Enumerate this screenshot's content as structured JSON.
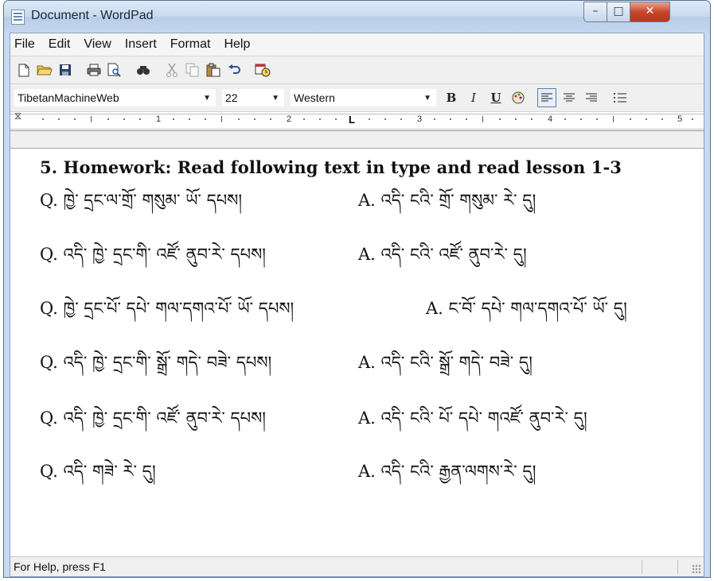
{
  "window": {
    "title": "Document - WordPad",
    "min_symbol": "–",
    "max_symbol": "□",
    "close_symbol": "✕"
  },
  "menu": [
    "File",
    "Edit",
    "View",
    "Insert",
    "Format",
    "Help"
  ],
  "toolbar_icons": [
    "new-document",
    "open-folder",
    "save",
    "print",
    "print-preview",
    "find",
    "cut",
    "copy",
    "paste",
    "undo",
    "date-time"
  ],
  "format": {
    "font": "TibetanMachineWeb",
    "size": "22",
    "script": "Western",
    "bold": "B",
    "italic": "I",
    "underline": "U"
  },
  "ruler": {
    "numbers": [
      "1",
      "2",
      "3",
      "4",
      "5"
    ],
    "tab_marker": "L"
  },
  "document": {
    "heading": "5. Homework: Read following text in type and read lesson 1-3",
    "lines": [
      {
        "q": "Q. ཁྱེ་ དྲང་ལ་གྲོ་ གསུམ་ ཡོ་ དཔས།",
        "a": "A. འདི་ ངའི་ གྲོ་ གསུམ་ རེ་ དུ།"
      },
      {
        "q": "Q. འདི་ ཁྱེ་ དྲང་གི་ འཛོ་ ནུབ་རེ་ དཔས།",
        "a": "A. འདི་ ངའི་ འཛོ་ ནུབ་རེ་ དུ།"
      },
      {
        "q": "Q. ཁྱེ་ དྲང་པོ་ དཔེ་ གལ་དགའ་པོ་ ཡོ་ དཔས།",
        "a": "A. ང་བོ་ དཔེ་ གལ་དགའ་པོ་ ཡོ་ དུ།"
      },
      {
        "q": "Q. འདི་ ཁྱེ་ དྲང་གི་ སྒྲོ་ གདེ་ བཟེ་ དཔས།",
        "a": "A. འདི་ ངའི་ སྒྲོ་ གདེ་ བཟེ་ དུ།"
      },
      {
        "q": "Q. འདི་ ཁྱེ་ དྲང་གི་ འཛོ་ ནུབ་རེ་ དཔས།",
        "a": "A. འདི་ ངའི་ པོ་ དཔེ་ གའཛོ་ ནུབ་རེ་ དུ།"
      },
      {
        "q": "Q. འདི་ གཟེ་ རེ་ དུ།",
        "a": "A. འདི་ ངའི་ རྒྱན་ལགས་རེ་ དུ།"
      }
    ]
  },
  "status": {
    "text": "For Help, press F1"
  }
}
